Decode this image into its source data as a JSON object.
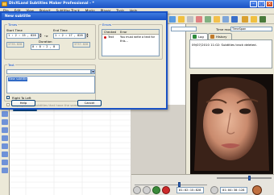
{
  "app": {
    "title": "DivXLand Subtitles Maker Professional - *"
  },
  "menu": [
    "File",
    "Edit",
    "View",
    "Project",
    "Subtitles Track",
    "Marks",
    "Player",
    "Tools",
    "Help"
  ],
  "right_panel": {
    "combo_left_value": "",
    "time_mode_label": "Time mode:",
    "time_mode_value": "TimeSpan",
    "tabs": [
      {
        "label": "Log"
      },
      {
        "label": "History"
      }
    ],
    "log_entry": "09/07/2010 11:02: Subtitles track deleted."
  },
  "player": {
    "current_time": "01:02:15:828",
    "total_time": "01:04:30:128",
    "position": 0.62,
    "volume": 0.6
  },
  "dialog": {
    "title": "New subtitle",
    "times_label": "Times",
    "start_time_label": "Start Time",
    "start_time_value": "1 : 2 : 15 , 828",
    "end_time_label": "End Time",
    "end_time_value": "1 : 2 : 17 , 828",
    "arrow": "->",
    "start_frame": "3735.828",
    "duration_label": "Duration",
    "duration_value": "0 : 0 : 2 , 0",
    "end_frame": "3737.828",
    "errors_label": "Errors",
    "errors_columns": [
      "Checked",
      "Error"
    ],
    "errors_rows": [
      {
        "checked": "Text",
        "error": "You must write a text for this..."
      }
    ],
    "text_label": "Text",
    "text_value": "",
    "style_value": "New subtitle",
    "right_to_left_label": "Right To Left",
    "apply_label": "Display in this subtitles that have the same text",
    "help_label": "Help",
    "cancel_label": "Cancel",
    "ok_label": "OK"
  },
  "colors": {
    "title_bar": "#1a52c4",
    "accent": "#316ac5",
    "error_icon": "#d11010"
  }
}
